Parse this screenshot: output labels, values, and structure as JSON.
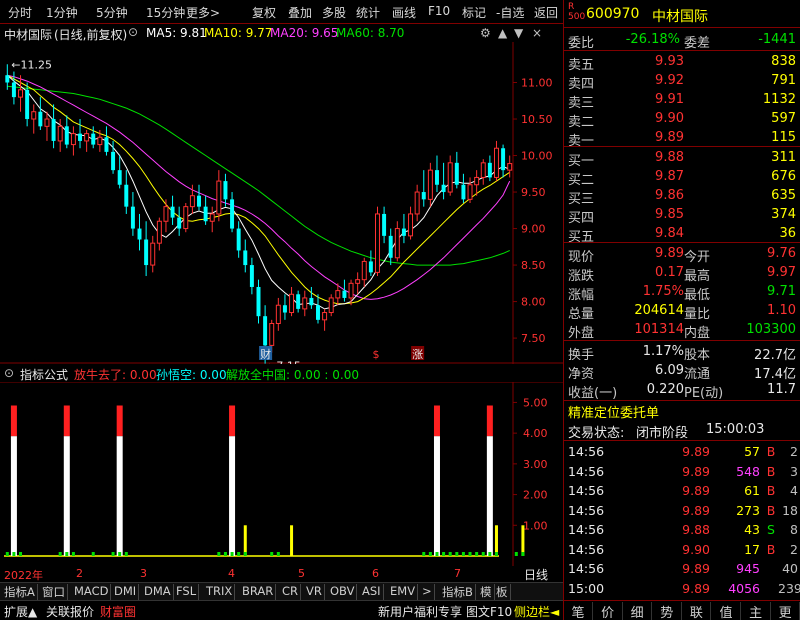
{
  "toolbar": {
    "items": [
      "分时",
      "1分钟",
      "5分钟",
      "15分钟",
      "更多",
      "复权",
      "叠加",
      "多股",
      "统计",
      "画线",
      "F10",
      "标记",
      "-自选",
      "返回"
    ]
  },
  "chart_header": {
    "stock_name": "中材国际",
    "mode": "(日线,前复权)",
    "ma5_label": "MA5: 9.81",
    "ma10_label": "MA10: 9.77",
    "ma20_label": "MA20: 9.65",
    "ma60_label": "MA60: 8.70"
  },
  "colors": {
    "up": "#ff3232",
    "down": "#00ffff",
    "ma5": "#ffffff",
    "ma10": "#ffff00",
    "ma20": "#ff40ff",
    "ma60": "#00e000",
    "grid": "#800000"
  },
  "chart_data": [
    {
      "type": "candlestick",
      "y_axis": {
        "ticks": [
          "11.00",
          "10.50",
          "10.00",
          "9.50",
          "9.00",
          "8.50",
          "8.00",
          "7.50"
        ],
        "ylim": [
          7.2,
          11.5
        ]
      },
      "annotations": {
        "high": "11.25",
        "low": "7.15",
        "markers": [
          "财",
          "$",
          "涨"
        ]
      },
      "candles": [
        [
          11.1,
          11.25,
          10.9,
          11.0
        ],
        [
          11.0,
          11.15,
          10.7,
          10.8
        ],
        [
          10.8,
          11.1,
          10.6,
          10.9
        ],
        [
          10.9,
          11.0,
          10.4,
          10.5
        ],
        [
          10.5,
          10.7,
          10.3,
          10.6
        ],
        [
          10.6,
          10.8,
          10.35,
          10.4
        ],
        [
          10.4,
          10.6,
          10.2,
          10.5
        ],
        [
          10.5,
          10.7,
          10.1,
          10.2
        ],
        [
          10.2,
          10.5,
          10.05,
          10.4
        ],
        [
          10.4,
          10.55,
          10.1,
          10.15
        ],
        [
          10.15,
          10.4,
          10.0,
          10.3
        ],
        [
          10.3,
          10.5,
          10.1,
          10.2
        ],
        [
          10.2,
          10.35,
          10.05,
          10.3
        ],
        [
          10.3,
          10.4,
          10.1,
          10.15
        ],
        [
          10.15,
          10.35,
          10.05,
          10.25
        ],
        [
          10.25,
          10.4,
          10.0,
          10.05
        ],
        [
          10.05,
          10.2,
          9.75,
          9.8
        ],
        [
          9.8,
          10.0,
          9.55,
          9.6
        ],
        [
          9.6,
          9.8,
          9.2,
          9.3
        ],
        [
          9.3,
          9.5,
          8.9,
          9.0
        ],
        [
          9.0,
          9.2,
          8.7,
          8.85
        ],
        [
          8.85,
          9.1,
          8.35,
          8.5
        ],
        [
          8.5,
          8.9,
          8.4,
          8.8
        ],
        [
          8.8,
          9.15,
          8.7,
          9.1
        ],
        [
          9.1,
          9.4,
          8.95,
          9.3
        ],
        [
          9.3,
          9.45,
          9.05,
          9.15
        ],
        [
          9.15,
          9.3,
          8.9,
          9.0
        ],
        [
          9.0,
          9.35,
          8.95,
          9.3
        ],
        [
          9.3,
          9.6,
          9.2,
          9.45
        ],
        [
          9.45,
          9.6,
          9.25,
          9.3
        ],
        [
          9.3,
          9.45,
          9.05,
          9.1
        ],
        [
          9.1,
          9.3,
          8.95,
          9.2
        ],
        [
          9.2,
          9.8,
          9.1,
          9.65
        ],
        [
          9.65,
          9.75,
          9.3,
          9.4
        ],
        [
          9.4,
          9.5,
          8.95,
          9.0
        ],
        [
          9.0,
          9.1,
          8.6,
          8.7
        ],
        [
          8.7,
          8.85,
          8.4,
          8.5
        ],
        [
          8.5,
          8.6,
          8.1,
          8.2
        ],
        [
          8.2,
          8.3,
          7.7,
          7.8
        ],
        [
          7.8,
          7.95,
          7.15,
          7.4
        ],
        [
          7.4,
          7.75,
          7.3,
          7.7
        ],
        [
          7.7,
          8.05,
          7.6,
          7.95
        ],
        [
          7.95,
          8.1,
          7.75,
          7.85
        ],
        [
          7.85,
          8.2,
          7.8,
          8.1
        ],
        [
          8.1,
          8.15,
          7.85,
          7.9
        ],
        [
          7.9,
          8.15,
          7.8,
          8.05
        ],
        [
          8.05,
          8.2,
          7.9,
          7.95
        ],
        [
          7.95,
          8.1,
          7.7,
          7.75
        ],
        [
          7.75,
          7.9,
          7.6,
          7.85
        ],
        [
          7.85,
          8.1,
          7.8,
          8.05
        ],
        [
          8.05,
          8.25,
          7.95,
          8.15
        ],
        [
          8.15,
          8.3,
          8.0,
          8.05
        ],
        [
          8.05,
          8.3,
          7.95,
          8.25
        ],
        [
          8.25,
          8.4,
          8.1,
          8.3
        ],
        [
          8.3,
          8.6,
          8.2,
          8.55
        ],
        [
          8.55,
          8.7,
          8.35,
          8.4
        ],
        [
          8.4,
          9.3,
          8.35,
          9.2
        ],
        [
          9.2,
          9.3,
          8.8,
          8.9
        ],
        [
          8.9,
          9.0,
          8.5,
          8.6
        ],
        [
          8.6,
          9.1,
          8.55,
          9.0
        ],
        [
          9.0,
          9.2,
          8.8,
          8.9
        ],
        [
          8.9,
          9.3,
          8.85,
          9.2
        ],
        [
          9.2,
          9.6,
          9.1,
          9.5
        ],
        [
          9.5,
          9.8,
          9.3,
          9.4
        ],
        [
          9.4,
          9.9,
          9.3,
          9.8
        ],
        [
          9.8,
          10.0,
          9.5,
          9.6
        ],
        [
          9.6,
          9.9,
          9.4,
          9.5
        ],
        [
          9.5,
          10.0,
          9.45,
          9.9
        ],
        [
          9.9,
          10.05,
          9.55,
          9.6
        ],
        [
          9.6,
          9.75,
          9.35,
          9.4
        ],
        [
          9.4,
          9.7,
          9.35,
          9.6
        ],
        [
          9.6,
          9.8,
          9.45,
          9.7
        ],
        [
          9.7,
          9.95,
          9.6,
          9.9
        ],
        [
          9.9,
          10.0,
          9.65,
          9.7
        ],
        [
          9.7,
          10.2,
          9.65,
          10.1
        ],
        [
          10.1,
          10.15,
          9.7,
          9.8
        ],
        [
          9.8,
          10.0,
          9.7,
          9.89
        ]
      ],
      "ma": {
        "ma5": [
          11.1,
          11.02,
          10.95,
          10.88,
          10.76,
          10.64,
          10.58,
          10.48,
          10.42,
          10.33,
          10.29,
          10.28,
          10.27,
          10.22,
          10.24,
          10.2,
          10.11,
          10.0,
          9.84,
          9.65,
          9.44,
          9.23,
          9.05,
          8.93,
          8.88,
          8.96,
          9.06,
          9.15,
          9.21,
          9.24,
          9.21,
          9.21,
          9.26,
          9.29,
          9.27,
          9.15,
          8.99,
          8.84,
          8.65,
          8.45,
          8.29,
          8.2,
          8.12,
          8.05,
          7.96,
          7.97,
          7.98,
          7.95,
          7.9,
          7.92,
          7.96,
          7.97,
          8.0,
          8.1,
          8.2,
          8.3,
          8.45,
          8.55,
          8.7,
          8.85,
          8.95,
          8.98,
          9.05,
          9.15,
          9.3,
          9.45,
          9.55,
          9.62,
          9.64,
          9.62,
          9.62,
          9.66,
          9.7,
          9.72,
          9.8,
          9.85,
          9.81
        ],
        "ma10": [
          11.1,
          11.05,
          11.0,
          10.95,
          10.9,
          10.82,
          10.74,
          10.66,
          10.6,
          10.53,
          10.46,
          10.42,
          10.38,
          10.34,
          10.3,
          10.27,
          10.22,
          10.15,
          10.06,
          9.96,
          9.85,
          9.72,
          9.58,
          9.45,
          9.33,
          9.23,
          9.16,
          9.11,
          9.1,
          9.12,
          9.13,
          9.15,
          9.17,
          9.2,
          9.21,
          9.19,
          9.15,
          9.08,
          9.0,
          8.9,
          8.77,
          8.64,
          8.52,
          8.4,
          8.3,
          8.2,
          8.12,
          8.06,
          8.02,
          7.99,
          7.97,
          7.97,
          7.98,
          8.0,
          8.05,
          8.11,
          8.18,
          8.26,
          8.34,
          8.44,
          8.54,
          8.63,
          8.72,
          8.81,
          8.9,
          8.99,
          9.08,
          9.17,
          9.26,
          9.34,
          9.41,
          9.48,
          9.54,
          9.59,
          9.65,
          9.71,
          9.77
        ],
        "ma20": [
          11.1,
          11.08,
          11.05,
          11.02,
          10.98,
          10.94,
          10.89,
          10.84,
          10.79,
          10.74,
          10.69,
          10.64,
          10.59,
          10.54,
          10.49,
          10.44,
          10.38,
          10.32,
          10.25,
          10.18,
          10.1,
          10.02,
          9.94,
          9.86,
          9.78,
          9.71,
          9.64,
          9.58,
          9.53,
          9.49,
          9.45,
          9.41,
          9.38,
          9.35,
          9.32,
          9.29,
          9.25,
          9.2,
          9.14,
          9.07,
          8.99,
          8.9,
          8.82,
          8.73,
          8.65,
          8.56,
          8.48,
          8.41,
          8.34,
          8.28,
          8.22,
          8.16,
          8.11,
          8.07,
          8.04,
          8.03,
          8.04,
          8.06,
          8.09,
          8.13,
          8.18,
          8.24,
          8.3,
          8.37,
          8.44,
          8.52,
          8.6,
          8.69,
          8.78,
          8.87,
          8.96,
          9.05,
          9.14,
          9.24,
          9.34,
          9.46,
          9.65
        ],
        "ma60": [
          10.95,
          10.94,
          10.93,
          10.92,
          10.91,
          10.9,
          10.89,
          10.88,
          10.87,
          10.86,
          10.85,
          10.83,
          10.81,
          10.79,
          10.77,
          10.74,
          10.71,
          10.68,
          10.65,
          10.61,
          10.57,
          10.52,
          10.47,
          10.42,
          10.36,
          10.3,
          10.24,
          10.18,
          10.12,
          10.06,
          10.0,
          9.94,
          9.88,
          9.82,
          9.76,
          9.7,
          9.64,
          9.58,
          9.52,
          9.45,
          9.38,
          9.31,
          9.24,
          9.17,
          9.1,
          9.03,
          8.97,
          8.91,
          8.86,
          8.81,
          8.77,
          8.73,
          8.69,
          8.66,
          8.63,
          8.6,
          8.58,
          8.56,
          8.54,
          8.53,
          8.52,
          8.51,
          8.5,
          8.5,
          8.5,
          8.5,
          8.5,
          8.5,
          8.51,
          8.52,
          8.54,
          8.56,
          8.58,
          8.6,
          8.63,
          8.66,
          8.7
        ]
      }
    },
    {
      "type": "bar",
      "header": {
        "name": "指标公式",
        "s1": "放牛去了: 0.00",
        "s2": "孙悟空: 0.00",
        "s3": "解放全中国: 0.00 : 0.00"
      },
      "y_axis": {
        "ticks": [
          "5.00",
          "4.00",
          "3.00",
          "2.00",
          "1.00"
        ],
        "ylim": [
          0,
          5.6
        ]
      },
      "tall_bars": [
        1,
        9,
        17,
        34,
        65,
        73
      ],
      "yellow_bars": [
        36,
        43,
        74,
        78
      ],
      "green_ticks": [
        0,
        1,
        2,
        8,
        9,
        10,
        13,
        16,
        17,
        18,
        32,
        33,
        34,
        35,
        36,
        40,
        41,
        63,
        64,
        65,
        66,
        67,
        68,
        69,
        70,
        71,
        72,
        73,
        74,
        77,
        78
      ]
    }
  ],
  "time_axis": {
    "labels": [
      "2022年",
      "2",
      "3",
      "4",
      "5",
      "6",
      "7"
    ],
    "right_label": "日线"
  },
  "bottom_tabs": [
    "指标A",
    "窗口",
    "MACD",
    "DMI",
    "DMA",
    "FSL",
    "TRIX",
    "BRAR",
    "CR",
    "VR",
    "OBV",
    "ASI",
    "EMV",
    ">",
    "指标B",
    "模",
    "板"
  ],
  "status_bar": {
    "left": [
      "扩展▲",
      "关联报价",
      "财富圈"
    ],
    "right": [
      "新用户福利专享",
      "图文F10",
      "侧边栏◄"
    ]
  },
  "quote": {
    "code": "600970",
    "name": "中材国际",
    "badge_r": "R",
    "badge_n": "500",
    "weibi_label": "委比",
    "weibi": "-26.18%",
    "weicha_label": "委差",
    "weicha": "-1441",
    "asks": [
      {
        "label": "卖五",
        "price": "9.93",
        "vol": "838"
      },
      {
        "label": "卖四",
        "price": "9.92",
        "vol": "791"
      },
      {
        "label": "卖三",
        "price": "9.91",
        "vol": "1132"
      },
      {
        "label": "卖二",
        "price": "9.90",
        "vol": "597"
      },
      {
        "label": "卖一",
        "price": "9.89",
        "vol": "115"
      }
    ],
    "bids": [
      {
        "label": "买一",
        "price": "9.88",
        "vol": "311"
      },
      {
        "label": "买二",
        "price": "9.87",
        "vol": "676"
      },
      {
        "label": "买三",
        "price": "9.86",
        "vol": "635"
      },
      {
        "label": "买四",
        "price": "9.85",
        "vol": "374"
      },
      {
        "label": "买五",
        "price": "9.84",
        "vol": "36"
      }
    ],
    "stats": [
      {
        "l1": "现价",
        "v1": "9.89",
        "l2": "今开",
        "v2": "9.76"
      },
      {
        "l1": "涨跌",
        "v1": "0.17",
        "l2": "最高",
        "v2": "9.97"
      },
      {
        "l1": "涨幅",
        "v1": "1.75%",
        "l2": "最低",
        "v2": "9.71"
      },
      {
        "l1": "总量",
        "v1": "204614",
        "l2": "量比",
        "v2": "1.10"
      },
      {
        "l1": "外盘",
        "v1": "101314",
        "l2": "内盘",
        "v2": "103300"
      }
    ],
    "stats2": [
      {
        "l1": "换手",
        "v1": "1.17%",
        "l2": "股本",
        "v2": "22.7亿"
      },
      {
        "l1": "净资",
        "v1": "6.09",
        "l2": "流通",
        "v2": "17.4亿"
      },
      {
        "l1": "收益(一)",
        "v1": "0.220",
        "l2": "PE(动)",
        "v2": "11.7"
      }
    ],
    "precise_label": "精准定位委托单",
    "trade_state_label": "交易状态:",
    "trade_state": "闭市阶段",
    "trade_time": "15:00:03",
    "ticks": [
      {
        "t": "14:56",
        "p": "9.89",
        "v": "57",
        "bs": "B",
        "n": "2"
      },
      {
        "t": "14:56",
        "p": "9.89",
        "v": "548",
        "bs": "B",
        "n": "3"
      },
      {
        "t": "14:56",
        "p": "9.89",
        "v": "61",
        "bs": "B",
        "n": "4"
      },
      {
        "t": "14:56",
        "p": "9.89",
        "v": "273",
        "bs": "B",
        "n": "18"
      },
      {
        "t": "14:56",
        "p": "9.88",
        "v": "43",
        "bs": "S",
        "n": "8"
      },
      {
        "t": "14:56",
        "p": "9.90",
        "v": "17",
        "bs": "B",
        "n": "2"
      },
      {
        "t": "14:56",
        "p": "9.89",
        "v": "945",
        "bs": "",
        "n": "40"
      },
      {
        "t": "15:00",
        "p": "9.89",
        "v": "4056",
        "bs": "",
        "n": "239"
      }
    ],
    "tabs": [
      "笔",
      "价",
      "细",
      "势",
      "联",
      "值",
      "主",
      "更"
    ]
  }
}
